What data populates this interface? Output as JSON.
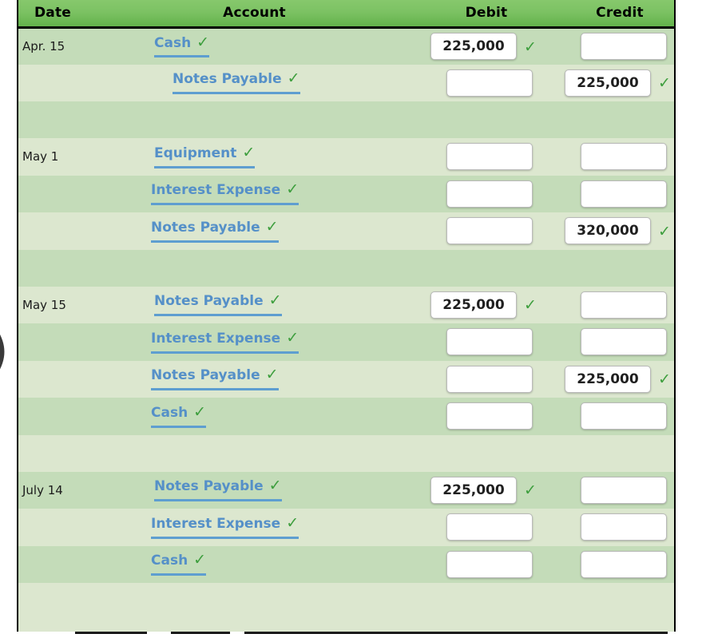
{
  "table": {
    "headers": {
      "date": "Date",
      "account": "Account",
      "debit": "Debit",
      "credit": "Credit"
    },
    "colors": {
      "header_green_top": "#86c86c",
      "header_green_bottom": "#63b24b",
      "row_dark": "#c4dcb9",
      "row_light": "#dce7cf",
      "link_blue": "#5590c8",
      "check_green": "#3d9e3d",
      "border_black": "#000000"
    },
    "check_glyph": "✓",
    "entries": [
      {
        "date": "Apr. 15",
        "lines": [
          {
            "date": "Apr. 15",
            "indent": 0,
            "account": "Cash",
            "account_checked": true,
            "debit": "225,000",
            "debit_checked": true,
            "credit": "",
            "credit_checked": false,
            "shade": "dark"
          },
          {
            "date": "",
            "indent": 1,
            "account": "Notes Payable",
            "account_checked": true,
            "debit": "",
            "debit_checked": false,
            "credit": "225,000",
            "credit_checked": true,
            "shade": "light"
          }
        ],
        "spacer_shade": "dark"
      },
      {
        "date": "May 1",
        "lines": [
          {
            "date": "May 1",
            "indent": 0,
            "account": "Equipment",
            "account_checked": true,
            "debit": "",
            "debit_checked": false,
            "credit": "",
            "credit_checked": false,
            "shade": "light"
          },
          {
            "date": "",
            "indent": 2,
            "account": "Interest Expense",
            "account_checked": true,
            "debit": "",
            "debit_checked": false,
            "credit": "",
            "credit_checked": false,
            "shade": "dark"
          },
          {
            "date": "",
            "indent": 2,
            "account": "Notes Payable",
            "account_checked": true,
            "debit": "",
            "debit_checked": false,
            "credit": "320,000",
            "credit_checked": true,
            "shade": "light"
          }
        ],
        "spacer_shade": "dark"
      },
      {
        "date": "May 15",
        "lines": [
          {
            "date": "May 15",
            "indent": 0,
            "account": "Notes Payable",
            "account_checked": true,
            "debit": "225,000",
            "debit_checked": true,
            "credit": "",
            "credit_checked": false,
            "shade": "light"
          },
          {
            "date": "",
            "indent": 2,
            "account": "Interest Expense",
            "account_checked": true,
            "debit": "",
            "debit_checked": false,
            "credit": "",
            "credit_checked": false,
            "shade": "dark"
          },
          {
            "date": "",
            "indent": 2,
            "account": "Notes Payable",
            "account_checked": true,
            "debit": "",
            "debit_checked": false,
            "credit": "225,000",
            "credit_checked": true,
            "shade": "light"
          },
          {
            "date": "",
            "indent": 2,
            "account": "Cash",
            "account_checked": true,
            "debit": "",
            "debit_checked": false,
            "credit": "",
            "credit_checked": false,
            "shade": "dark"
          }
        ],
        "spacer_shade": "light"
      },
      {
        "date": "July 14",
        "lines": [
          {
            "date": "July 14",
            "indent": 0,
            "account": "Notes Payable",
            "account_checked": true,
            "debit": "225,000",
            "debit_checked": true,
            "credit": "",
            "credit_checked": false,
            "shade": "dark"
          },
          {
            "date": "",
            "indent": 2,
            "account": "Interest Expense",
            "account_checked": true,
            "debit": "",
            "debit_checked": false,
            "credit": "",
            "credit_checked": false,
            "shade": "light"
          },
          {
            "date": "",
            "indent": 2,
            "account": "Cash",
            "account_checked": true,
            "debit": "",
            "debit_checked": false,
            "credit": "",
            "credit_checked": false,
            "shade": "dark"
          }
        ],
        "spacer_shade": "light"
      }
    ]
  },
  "page_edge": {
    "left_paren_glyph": ")"
  }
}
